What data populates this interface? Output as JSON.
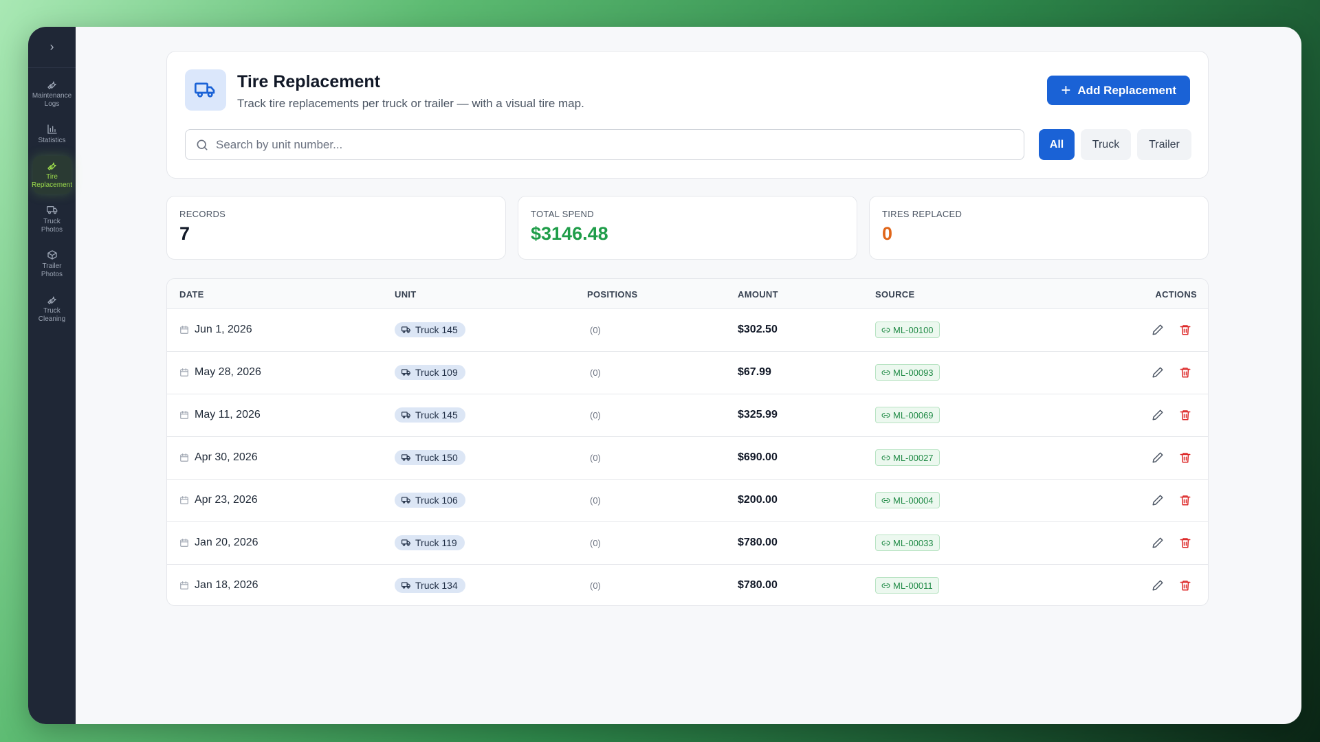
{
  "sidebar": {
    "toggle": "›",
    "items": [
      {
        "label": "Maintenance Logs",
        "icon": "wrench-icon",
        "active": false
      },
      {
        "label": "Statistics",
        "icon": "bar-chart-icon",
        "active": false
      },
      {
        "label": "Tire Replacement",
        "icon": "wrench-icon",
        "active": true
      },
      {
        "label": "Truck Photos",
        "icon": "truck-icon",
        "active": false
      },
      {
        "label": "Trailer Photos",
        "icon": "box-icon",
        "active": false
      },
      {
        "label": "Truck Cleaning",
        "icon": "wrench-icon",
        "active": false
      }
    ]
  },
  "header": {
    "title": "Tire Replacement",
    "subtitle": "Track tire replacements per truck or trailer — with a visual tire map.",
    "add_button": "Add Replacement"
  },
  "search": {
    "placeholder": "Search by unit number...",
    "value": ""
  },
  "filters": [
    {
      "label": "All",
      "active": true
    },
    {
      "label": "Truck",
      "active": false
    },
    {
      "label": "Trailer",
      "active": false
    }
  ],
  "stats": [
    {
      "label": "RECORDS",
      "value": "7",
      "color": "#111827"
    },
    {
      "label": "TOTAL SPEND",
      "value": "$3146.48",
      "color": "#1f9d49"
    },
    {
      "label": "TIRES REPLACED",
      "value": "0",
      "color": "#e0661a"
    }
  ],
  "table": {
    "headers": [
      "DATE",
      "UNIT",
      "POSITIONS",
      "AMOUNT",
      "SOURCE",
      "ACTIONS"
    ],
    "rows": [
      {
        "date": "Jun 1, 2026",
        "unit": "Truck 145",
        "positions": "(0)",
        "amount": "$302.50",
        "source": "ML-00100"
      },
      {
        "date": "May 28, 2026",
        "unit": "Truck 109",
        "positions": "(0)",
        "amount": "$67.99",
        "source": "ML-00093"
      },
      {
        "date": "May 11, 2026",
        "unit": "Truck 145",
        "positions": "(0)",
        "amount": "$325.99",
        "source": "ML-00069"
      },
      {
        "date": "Apr 30, 2026",
        "unit": "Truck 150",
        "positions": "(0)",
        "amount": "$690.00",
        "source": "ML-00027"
      },
      {
        "date": "Apr 23, 2026",
        "unit": "Truck 106",
        "positions": "(0)",
        "amount": "$200.00",
        "source": "ML-00004"
      },
      {
        "date": "Jan 20, 2026",
        "unit": "Truck 119",
        "positions": "(0)",
        "amount": "$780.00",
        "source": "ML-00033"
      },
      {
        "date": "Jan 18, 2026",
        "unit": "Truck 134",
        "positions": "(0)",
        "amount": "$780.00",
        "source": "ML-00011"
      }
    ]
  },
  "colors": {
    "accent": "#1a62d6",
    "sidebar_bg": "#1f2736",
    "active_nav": "#9ad94b",
    "delete": "#dc2626"
  }
}
